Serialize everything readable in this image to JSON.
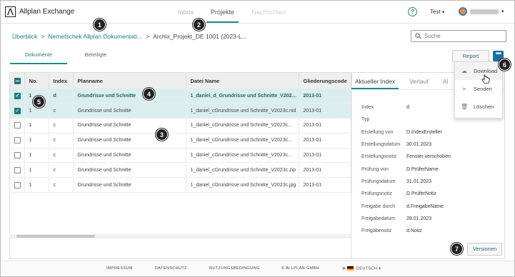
{
  "app": {
    "title": "Allplan Exchange",
    "logo_glyph": "⋀"
  },
  "nav": {
    "items": [
      {
        "label": "Inbox",
        "state": "inactive"
      },
      {
        "label": "Projekte",
        "state": "active"
      },
      {
        "label": "Nachrichten",
        "state": "disabled"
      }
    ]
  },
  "header": {
    "help_glyph": "?",
    "project_selector": "Test",
    "user_name": "Daniel Herr"
  },
  "breadcrumb": {
    "items": [
      "Überblick",
      "Nemetschek Allplan Dokumentati...",
      "Archix_Projekt_DE 1001 (2023-L..."
    ],
    "separator": ">"
  },
  "search": {
    "placeholder": "Suche"
  },
  "tabs": [
    {
      "label": "Dokumente",
      "active": true
    },
    {
      "label": "Beteiligte",
      "active": false
    }
  ],
  "toolbar": {
    "report_label": "Report",
    "more_label": "•••"
  },
  "table": {
    "columns": [
      "",
      "No.",
      "Index",
      "Planname",
      "Datei Name",
      "Gliederungscode"
    ],
    "rows": [
      {
        "checked": true,
        "no": "1",
        "index": "d",
        "planname": "Grundrisse und Schnitte",
        "datei": "1_daniel_d_Grundrisse und Schnitte_V2023c...",
        "code": "2013-01"
      },
      {
        "checked": true,
        "no": "1",
        "index": "c",
        "planname": "Grundrisse und Schnitte",
        "datei": "1_daniel_cGrundrisse und Schnitte_V2023c.nid",
        "code": "2013-01"
      },
      {
        "checked": false,
        "no": "1",
        "index": "c",
        "planname": "Grundrisse und Schnitte",
        "datei": "1_daniel_cGrundrisse und Schnitte_V2023c...",
        "code": "2013-01"
      },
      {
        "checked": false,
        "no": "1",
        "index": "c",
        "planname": "Grundrisse und Schnitte",
        "datei": "1_daniel_cGrundrisse und Schnitte_V2023c...",
        "code": "2013-01"
      },
      {
        "checked": false,
        "no": "1",
        "index": "c",
        "planname": "Grundrisse und Schnitte",
        "datei": "1_daniel_cGrundrisse und Schnitte_V2023c...",
        "code": "2013-01"
      },
      {
        "checked": false,
        "no": "1",
        "index": "c",
        "planname": "Grundrisse und Schnitte",
        "datei": "1_daniel_cGrundrisse und Schnitte_V2023c.zip",
        "code": "2013-01"
      },
      {
        "checked": false,
        "no": "1",
        "index": "c",
        "planname": "Grundrisse und Schnitte",
        "datei": "1_daniel_cGrundrisse und Schnitte_V2023c.jpg",
        "code": "2013-01"
      }
    ]
  },
  "details": {
    "tabs": [
      "Aktueller Index",
      "Verlauf",
      "Al"
    ],
    "props": [
      {
        "k": "Index",
        "v": "d"
      },
      {
        "k": "Typ",
        "v": ""
      },
      {
        "k": "Erstellung von",
        "v": "D.IndexErsteller"
      },
      {
        "k": "Erstellungsdatum",
        "v": "30.01.2023"
      },
      {
        "k": "Erstellungsnotiz",
        "v": "Fenster verschoben"
      },
      {
        "k": "Prüfung von",
        "v": "D.PrüferName"
      },
      {
        "k": "Prüfungsdatum",
        "v": "31.01.2023"
      },
      {
        "k": "Prüfungsnotiz",
        "v": "D.PrüferNotiz"
      },
      {
        "k": "Freigabe durch",
        "v": "d.FreigabeName"
      },
      {
        "k": "Freigabedatum",
        "v": "28.01.2023"
      },
      {
        "k": "Freigabenotiz",
        "v": "d.Notiz"
      }
    ],
    "versions_label": "Versionen"
  },
  "dropdown": {
    "items": [
      {
        "label": "Download",
        "icon": "cloud-download-icon",
        "glyph": "☁"
      },
      {
        "label": "Senden",
        "icon": "send-icon",
        "glyph": "➢"
      },
      {
        "label": "Löschen",
        "icon": "trash-icon",
        "glyph": "🗑"
      }
    ]
  },
  "badges": [
    "1",
    "2",
    "3",
    "4",
    "5",
    "6",
    "7"
  ],
  "footer": {
    "impressum": "IMPRESSUM",
    "datenschutz": "DATENSCHUTZ",
    "nutzung": "NUTZUNGSBEDINGUNG",
    "copyright": "© ALLPLAN GMBH",
    "language": "DEUTSCH"
  },
  "colors": {
    "accent": "#1f8c86",
    "link": "#1f7a80",
    "selection": "#dbeeee",
    "more_button": "#1b6fa3"
  }
}
